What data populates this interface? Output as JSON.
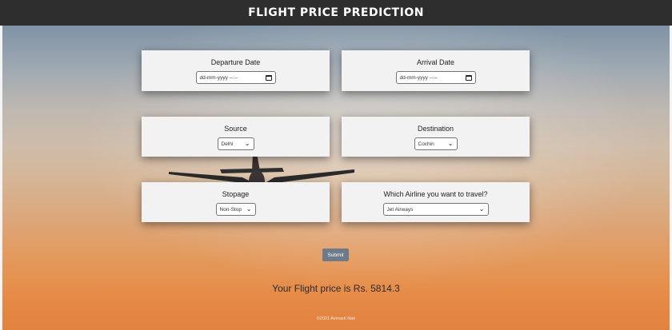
{
  "header": {
    "title": "FLIGHT PRICE PREDICTION"
  },
  "form": {
    "departure": {
      "label": "Departure Date",
      "placeholder": "dd-mm-yyyy --:--"
    },
    "arrival": {
      "label": "Arrival Date",
      "placeholder": "dd-mm-yyyy --:--"
    },
    "source": {
      "label": "Source",
      "selected": "Delhi"
    },
    "destination": {
      "label": "Destination",
      "selected": "Cochin"
    },
    "stopage": {
      "label": "Stopage",
      "selected": "Non-Stop"
    },
    "airline": {
      "label": "Which Airline you want to travel?",
      "selected": "Jet Airways"
    }
  },
  "submit_label": "Submit",
  "result_text": "Your Flight price is Rs. 5814.3",
  "footer_text": "©2021 Avinash Nair",
  "icons": {
    "date_picker": "calendar-icon",
    "dropdown": "chevron-down-icon"
  },
  "colors": {
    "header_bg": "#2e2e2e",
    "card_bg": "#f2f2f2",
    "submit_bg": "#6c7a89",
    "sky_top": "#7f93a6",
    "sky_bottom": "#e2823f"
  }
}
